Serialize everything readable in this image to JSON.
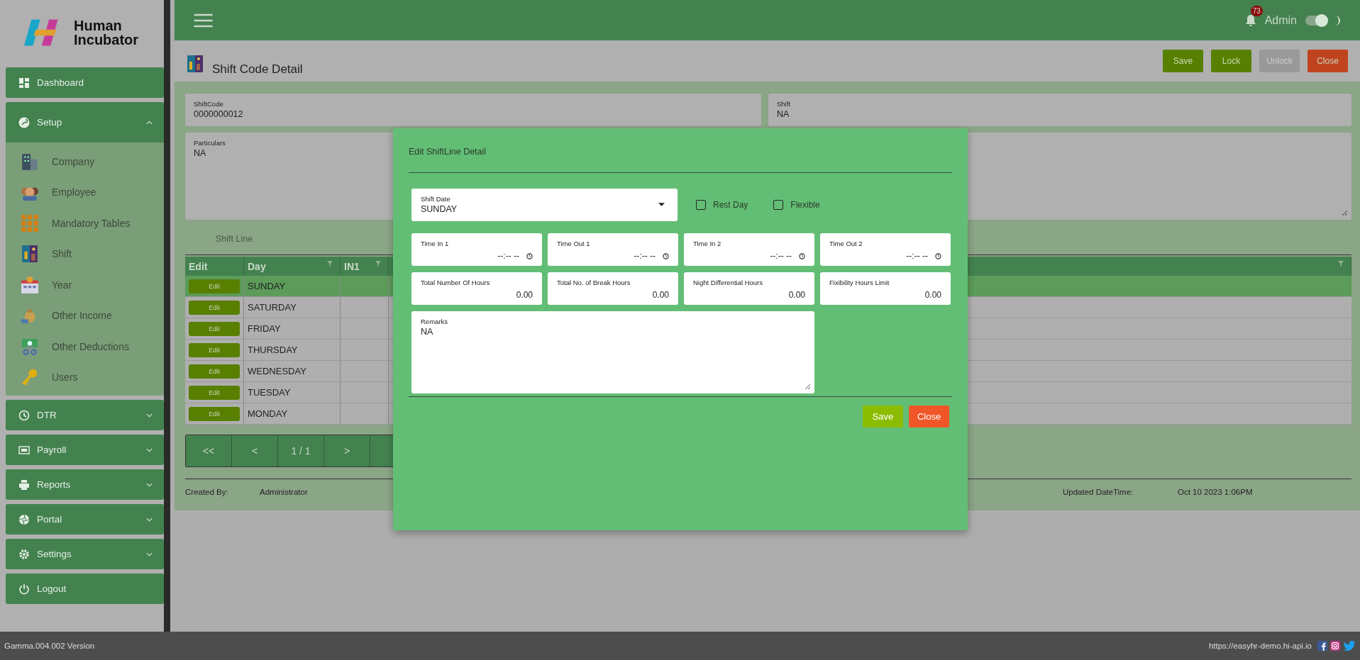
{
  "brand": {
    "name": "Human Incubator"
  },
  "sidebar": {
    "items": [
      {
        "label": "Dashboard",
        "kind": "link"
      },
      {
        "label": "Setup",
        "kind": "group",
        "expanded": true,
        "children": [
          {
            "label": "Company"
          },
          {
            "label": "Employee"
          },
          {
            "label": "Mandatory Tables"
          },
          {
            "label": "Shift"
          },
          {
            "label": "Year"
          },
          {
            "label": "Other Income"
          },
          {
            "label": "Other Deductions"
          },
          {
            "label": "Users"
          }
        ]
      },
      {
        "label": "DTR",
        "kind": "group",
        "expanded": false
      },
      {
        "label": "Payroll",
        "kind": "group",
        "expanded": false
      },
      {
        "label": "Reports",
        "kind": "group",
        "expanded": false
      },
      {
        "label": "Portal",
        "kind": "group",
        "expanded": false
      },
      {
        "label": "Settings",
        "kind": "group",
        "expanded": false
      },
      {
        "label": "Logout",
        "kind": "link"
      }
    ]
  },
  "header": {
    "notifications": "73",
    "user": "Admin",
    "theme_toggle_on": true
  },
  "page": {
    "title": "Shift Code Detail",
    "buttons": [
      {
        "label": "Save",
        "kind": "primary",
        "disabled": false
      },
      {
        "label": "Lock",
        "kind": "primary",
        "disabled": false
      },
      {
        "label": "Unlock",
        "kind": "primary",
        "disabled": true
      },
      {
        "label": "Close",
        "kind": "danger",
        "disabled": false
      }
    ]
  },
  "form": {
    "shift_code": {
      "label": "ShiftCode",
      "value": "0000000012"
    },
    "shift": {
      "label": "Shift",
      "value": "NA"
    },
    "particulars": {
      "label": "Particulars",
      "value": "NA"
    }
  },
  "shift_line": {
    "title": "Shift Line",
    "columns": [
      "Edit",
      "Day",
      "IN1"
    ],
    "rows": [
      {
        "action": "Edit",
        "day": "SUNDAY",
        "selected": true
      },
      {
        "action": "Edit",
        "day": "SATURDAY",
        "selected": false
      },
      {
        "action": "Edit",
        "day": "FRIDAY",
        "selected": false
      },
      {
        "action": "Edit",
        "day": "THURSDAY",
        "selected": false
      },
      {
        "action": "Edit",
        "day": "WEDNESDAY",
        "selected": false
      },
      {
        "action": "Edit",
        "day": "TUESDAY",
        "selected": false
      },
      {
        "action": "Edit",
        "day": "MONDAY",
        "selected": false
      }
    ],
    "pager": [
      "<<",
      "<",
      "1 / 1",
      ">"
    ]
  },
  "audit": {
    "created_by_label": "Created By:",
    "created_by": "Administrator",
    "updated_label": "Updated DateTime:",
    "updated": "Oct 10 2023 1:06PM"
  },
  "modal": {
    "title": "Edit ShiftLine Detail",
    "shift_date": {
      "label": "Shift Date",
      "value": "SUNDAY"
    },
    "checkboxes": [
      {
        "label": "Rest Day",
        "checked": false
      },
      {
        "label": "Flexible",
        "checked": false
      }
    ],
    "times": [
      {
        "label": "Time In 1",
        "value": "--:-- --"
      },
      {
        "label": "Time Out 1",
        "value": "--:-- --"
      },
      {
        "label": "Time In 2",
        "value": "--:-- --"
      },
      {
        "label": "Time Out 2",
        "value": "--:-- --"
      }
    ],
    "hours": [
      {
        "label": "Total Number Of Hours",
        "value": "0.00"
      },
      {
        "label": "Total No. of Break Hours",
        "value": "0.00"
      },
      {
        "label": "Night Differential Hours",
        "value": "0.00"
      },
      {
        "label": "Fixibility Hours Limit",
        "value": "0.00"
      }
    ],
    "remarks": {
      "label": "Remarks",
      "value": "NA"
    },
    "buttons": [
      {
        "label": "Save",
        "kind": "primary"
      },
      {
        "label": "Close",
        "kind": "danger"
      }
    ]
  },
  "footer": {
    "version": "Gamma.004.002 Version",
    "url": "https://easyhr-demo.hi-api.io"
  }
}
